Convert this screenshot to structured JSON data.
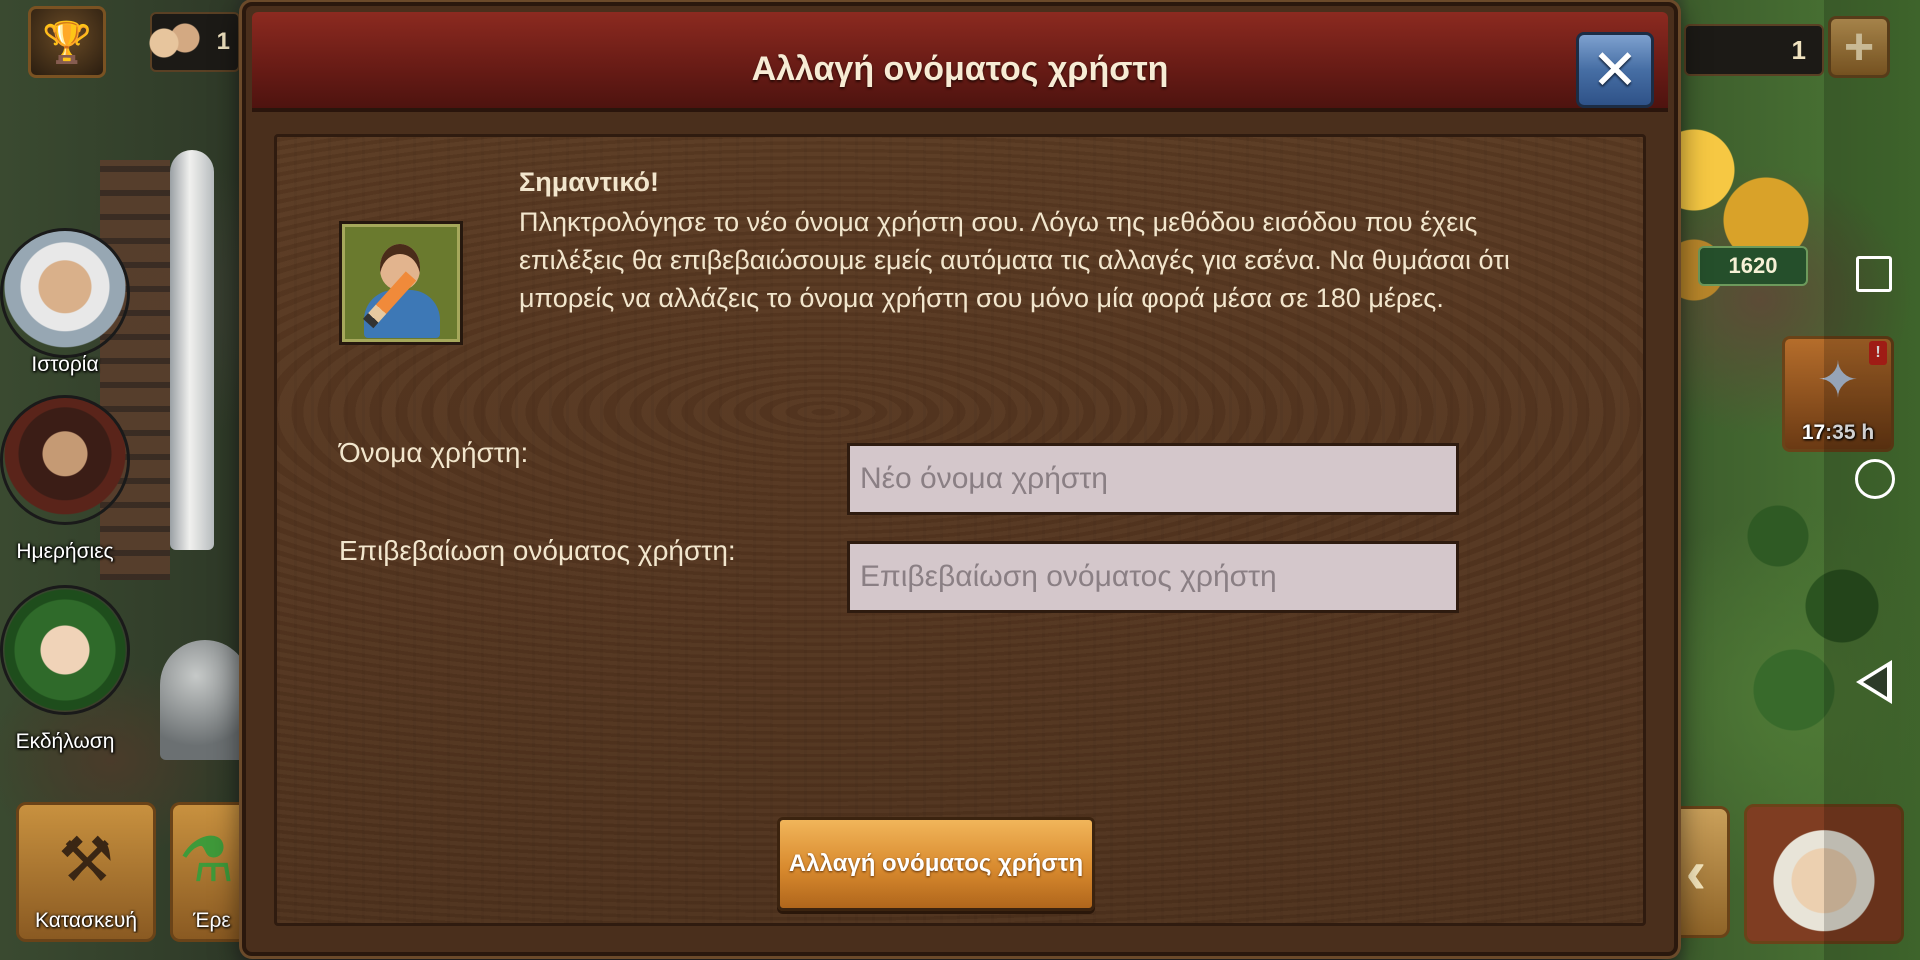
{
  "modal": {
    "title": "Αλλαγή ονόματος χρήστη",
    "important_heading": "Σημαντικό!",
    "important_text": "Πληκτρολόγησε το νέο όνομα χρήστη σου. Λόγω της μεθόδου εισόδου που έχεις επιλέξεις θα επιβεβαιώσουμε εμείς αυτόματα τις αλλαγές για εσένα. Να θυμάσαι ότι μπορείς να αλλάζεις το όνομα χρήστη σου μόνο μία φορά μέσα σε 180 μέρες.",
    "username_label": "Όνομα χρήστη:",
    "username_placeholder": "Νέο όνομα χρήστη",
    "username_value": "",
    "confirm_label": "Επιβεβαίωση ονόματος χρήστη:",
    "confirm_placeholder": "Επιβεβαίωση ονόματος χρήστη",
    "confirm_value": "",
    "submit_label": "Αλλαγή ονόματος χρήστη",
    "close_symbol": "✕"
  },
  "hud_left": {
    "players_count": "1",
    "side_buttons": [
      {
        "label": "Ιστορία"
      },
      {
        "label": "Ημερήσιες"
      },
      {
        "label": "Εκδήλωση"
      }
    ],
    "bottom_buttons": [
      {
        "label": "Κατασκευή"
      },
      {
        "label": "Έρε"
      }
    ]
  },
  "hud_right": {
    "counter": "1",
    "plus_symbol": "+",
    "coins": "1620",
    "timer": "17:35 h",
    "timer_alert": "!",
    "arrow_symbol": "‹"
  },
  "colors": {
    "header_red": "#6a1c16",
    "panel_wood": "#553620",
    "close_blue": "#466ea4",
    "submit_orange": "#d88a2e",
    "text_cream": "#f2e6cd"
  },
  "icons": {
    "trophy": "trophy-icon",
    "close": "close-icon",
    "portrait": "user-edit-portrait",
    "gift": "gift-icon"
  }
}
